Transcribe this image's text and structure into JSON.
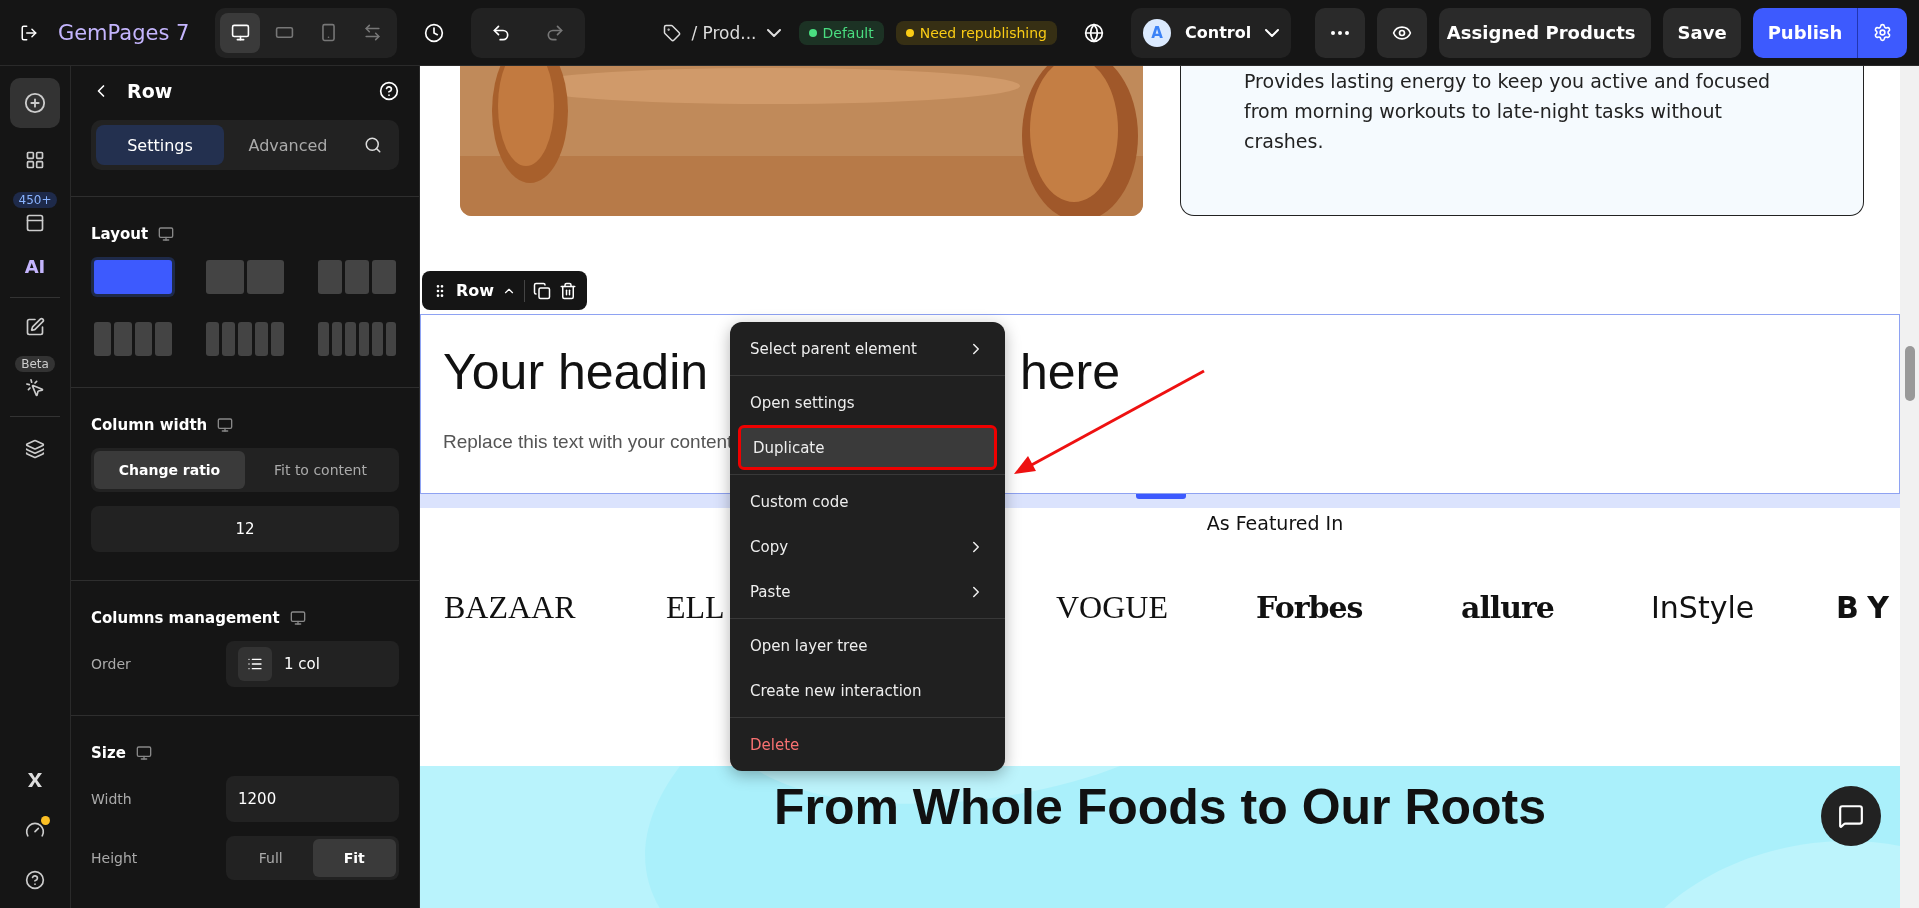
{
  "topbar": {
    "brand": "GemPages 7",
    "devices": [
      {
        "selected": true
      },
      {
        "selected": false
      },
      {
        "selected": false
      },
      {
        "selected": false
      }
    ],
    "page_name": "/ Prod...",
    "badges": [
      {
        "label": "Default",
        "color": "#4ade80"
      },
      {
        "label": "Need republishing",
        "color": "#facc15"
      }
    ],
    "variant": {
      "avatar": "A",
      "label": "Control"
    },
    "assigned": "Assigned Products",
    "save": "Save",
    "publish": "Publish"
  },
  "rail": {
    "count_badge": "450+",
    "ai_label": "AI",
    "beta_badge": "Beta"
  },
  "panel": {
    "title": "Row",
    "tabs": [
      {
        "label": "Settings",
        "selected": true
      },
      {
        "label": "Advanced",
        "selected": false
      }
    ],
    "layout": {
      "title": "Layout",
      "options": [
        {
          "selected": true
        },
        {
          "selected": false
        },
        {
          "selected": false
        },
        {
          "selected": false
        },
        {
          "selected": false
        },
        {
          "selected": false
        }
      ]
    },
    "column_width": {
      "title": "Column width",
      "options": [
        {
          "label": "Change ratio",
          "selected": true
        },
        {
          "label": "Fit to content",
          "selected": false
        }
      ],
      "value": "12"
    },
    "columns_management": {
      "title": "Columns management",
      "order_label": "Order",
      "order_value": "1 col"
    },
    "size": {
      "title": "Size",
      "width_label": "Width",
      "width_value": "1200",
      "height_label": "Height",
      "height_options": [
        {
          "label": "Full",
          "selected": false
        },
        {
          "label": "Fit",
          "selected": true
        }
      ]
    }
  },
  "canvas": {
    "feature_text": "Provides lasting energy to keep you active and focused from morning workouts to late-night tasks without crashes.",
    "row_toolbar": {
      "label": "Row"
    },
    "heading_start": "Your headin",
    "heading_end": "here",
    "paragraph": "Replace this text with your content",
    "featured_title": "As Featured In",
    "logos": [
      {
        "label": "BAZAAR",
        "kind": "serif"
      },
      {
        "label": "ELL",
        "kind": "serif"
      },
      {
        "label": "VOGUE",
        "kind": "serif"
      },
      {
        "label": "Forbes",
        "kind": "bold"
      },
      {
        "label": "allure",
        "kind": "bold"
      },
      {
        "label": "InStyle",
        "kind": "sans"
      },
      {
        "label": "BY",
        "kind": "wide"
      }
    ],
    "section_heading": "From Whole Foods to Our Roots"
  },
  "context_menu": [
    [
      {
        "label": "Select parent element",
        "submenu": true,
        "highlighted": false,
        "kind": "normal"
      }
    ],
    [
      {
        "label": "Open settings",
        "submenu": false,
        "highlighted": false,
        "kind": "normal"
      },
      {
        "label": "Duplicate",
        "submenu": false,
        "highlighted": true,
        "kind": "normal"
      }
    ],
    [
      {
        "label": "Custom code",
        "submenu": false,
        "highlighted": false,
        "kind": "normal"
      },
      {
        "label": "Copy",
        "submenu": true,
        "highlighted": false,
        "kind": "normal"
      },
      {
        "label": "Paste",
        "submenu": true,
        "highlighted": false,
        "kind": "normal"
      }
    ],
    [
      {
        "label": "Open layer tree",
        "submenu": false,
        "highlighted": false,
        "kind": "normal"
      },
      {
        "label": "Create new interaction",
        "submenu": false,
        "highlighted": false,
        "kind": "normal"
      }
    ],
    [
      {
        "label": "Delete",
        "submenu": false,
        "highlighted": false,
        "kind": "danger"
      }
    ]
  ]
}
